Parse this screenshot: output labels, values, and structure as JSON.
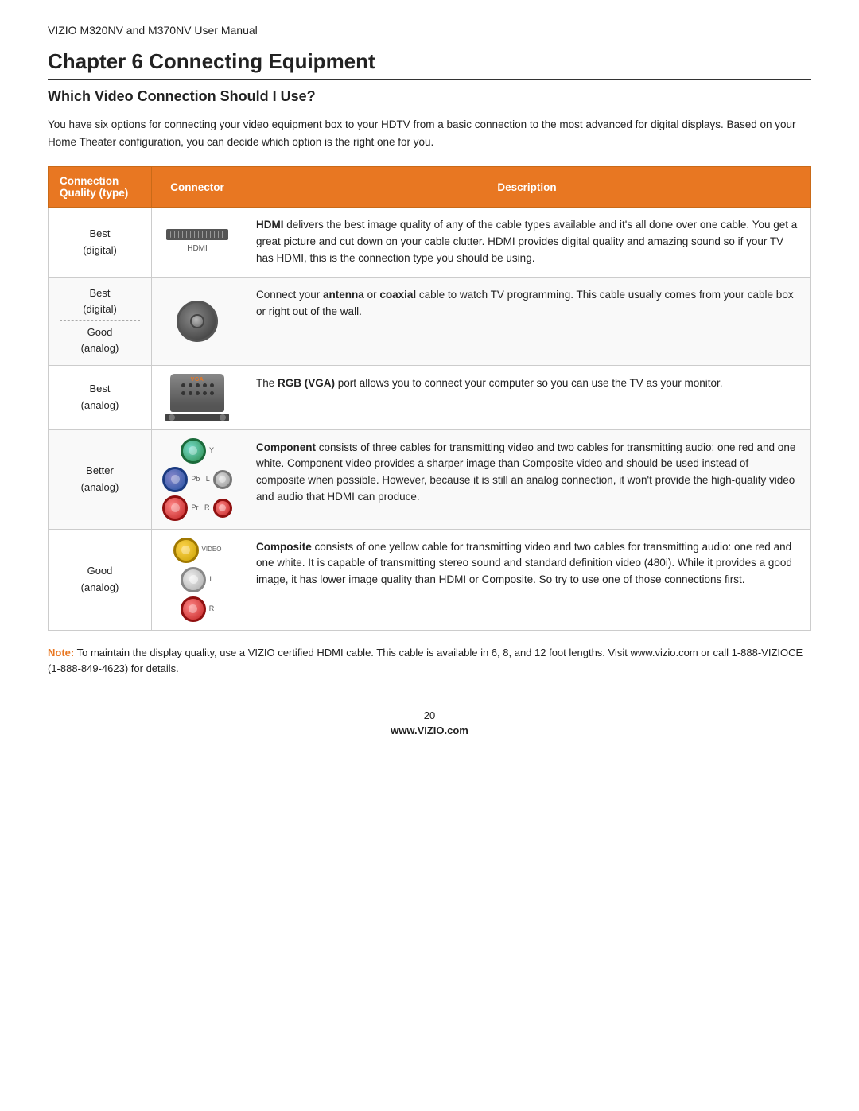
{
  "header": {
    "manual_title": "VIZIO M320NV and M370NV User Manual"
  },
  "chapter": {
    "title": "Chapter 6 Connecting Equipment",
    "section_title": "Which Video Connection Should I Use?",
    "intro": "You have six options for connecting your video equipment box to your HDTV from a basic connection to the most advanced for digital displays. Based on your Home Theater configuration, you can decide which option is the right one for you."
  },
  "table": {
    "headers": {
      "quality": "Connection Quality (type)",
      "connector": "Connector",
      "description": "Description"
    },
    "rows": [
      {
        "quality": "Best\n(digital)",
        "connector_type": "hdmi",
        "connector_label": "HDMI",
        "description_html": "<b>HDMI</b> delivers the best image quality of any of the cable types available and it's all done over one cable. You get a great picture and cut down on your cable clutter. HDMI provides digital quality and amazing sound so if your TV has HDMI, this is the connection type you should be using."
      },
      {
        "quality_line1": "Best",
        "quality_line2": "(digital)",
        "quality_line3": "Good",
        "quality_line4": "(analog)",
        "connector_type": "coax",
        "description_html": "Connect your <b>antenna</b> or <b>coaxial</b> cable to watch TV programming. This cable usually comes from your cable box or right out of the wall."
      },
      {
        "quality": "Best\n(analog)",
        "connector_type": "vga",
        "description_html": "The <b>RGB (VGA)</b> port allows you to connect your computer so you can use the TV as your monitor."
      },
      {
        "quality": "Better\n(analog)",
        "connector_type": "component",
        "description_html": "<b>Component</b> consists of three cables for transmitting video and two cables for transmitting audio: one red and one white. Component video provides a sharper image than Composite video and should be used instead of composite when possible. However, because it is still an analog connection, it won't provide the high-quality video and audio that HDMI can produce."
      },
      {
        "quality": "Good\n(analog)",
        "connector_type": "composite",
        "description_html": "<b>Composite</b> consists of one yellow cable for transmitting video and two cables for transmitting audio: one red and one white. It is capable of transmitting stereo sound and standard definition video (480i). While it provides a good image, it has lower image quality than HDMI or Composite. So try to use one of those connections first."
      }
    ]
  },
  "note": {
    "label": "Note:",
    "text": " To maintain the display quality, use a VIZIO certified HDMI cable. This cable is available in 6, 8, and 12 foot lengths. Visit www.vizio.com or call 1-888-VIZIOCE (1-888-849-4623) for details."
  },
  "footer": {
    "page_number": "20",
    "website": "www.VIZIO.com"
  }
}
